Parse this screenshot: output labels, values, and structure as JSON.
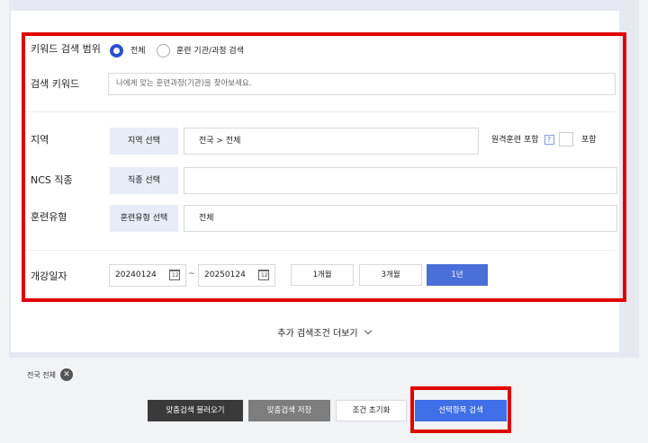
{
  "keyword_scope": {
    "label": "키워드 검색 범위",
    "options": [
      "전체",
      "훈련 기관/과정 검색"
    ],
    "selected": "전체"
  },
  "search_keyword": {
    "label": "검색 키워드",
    "placeholder": "나에게 맞는 훈련과정(기관)을 찾아보세요."
  },
  "region": {
    "label": "지역",
    "button": "지역 선택",
    "value": "전국 > 전체",
    "remote_label": "원격훈련 포함",
    "help": "?",
    "include_label": "포함"
  },
  "ncs": {
    "label": "NCS 직종",
    "button": "직종 선택",
    "value": ""
  },
  "training_type": {
    "label": "훈련유형",
    "button": "훈련유형 선택",
    "value": "전체"
  },
  "start_date": {
    "label": "개강일자",
    "from": "20240124",
    "tilde": "~",
    "to": "20250124",
    "cal_day": "12",
    "periods": [
      "1개월",
      "3개월",
      "1년"
    ],
    "active_period": "1년"
  },
  "more_conditions": "추가 검색조건 더보기",
  "chip_label": "전국 전체",
  "actions": {
    "load": "맞춤검색 불러오기",
    "save": "맞춤검색 저장",
    "reset": "조건 초기화",
    "search": "선택항목 검색"
  },
  "colors": {
    "accent": "#4a6fd8",
    "highlight": "#e00000",
    "dark_button": "#3a3a3a",
    "gray_button": "#7d7d7d"
  }
}
